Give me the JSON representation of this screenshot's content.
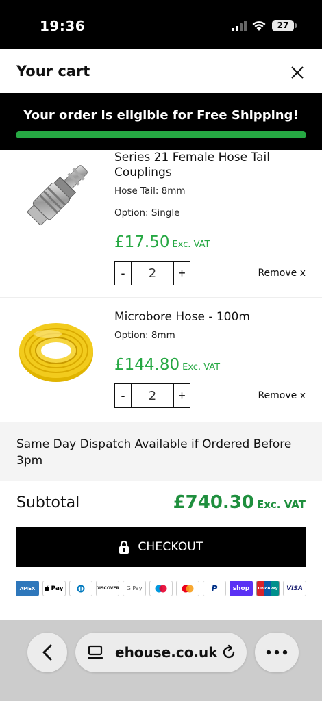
{
  "status_bar": {
    "time": "19:36",
    "battery": "27"
  },
  "cart": {
    "title": "Your cart"
  },
  "shipping_banner": {
    "text": "Your order is eligible for Free Shipping!",
    "progress_percent": 100,
    "color": "#26a843"
  },
  "items": [
    {
      "name": "Series 21 Female Hose Tail Couplings",
      "options": [
        "Hose Tail: 8mm",
        "Option: Single"
      ],
      "price": "£17.50",
      "vat_label": "Exc. VAT",
      "qty_minus": "-",
      "quantity": "2",
      "qty_plus": "+",
      "remove": "Remove x"
    },
    {
      "name": "Microbore Hose - 100m",
      "options": [
        "Option: 8mm"
      ],
      "price": "£144.80",
      "vat_label": "Exc. VAT",
      "qty_minus": "-",
      "quantity": "2",
      "qty_plus": "+",
      "remove": "Remove x"
    }
  ],
  "dispatch": {
    "text": "Same Day Dispatch Available if Ordered Before 3pm"
  },
  "subtotal": {
    "label": "Subtotal",
    "value": "£740.30",
    "vat_label": "Exc. VAT"
  },
  "checkout": {
    "label": "CHECKOUT"
  },
  "payment_methods": [
    {
      "name": "american-express",
      "label": "AMEX"
    },
    {
      "name": "apple-pay",
      "label": "Pay"
    },
    {
      "name": "diners-club",
      "label": ""
    },
    {
      "name": "discover",
      "label": "DISCOVER"
    },
    {
      "name": "google-pay",
      "label": "G Pay"
    },
    {
      "name": "maestro",
      "label": ""
    },
    {
      "name": "mastercard",
      "label": ""
    },
    {
      "name": "paypal",
      "label": "P"
    },
    {
      "name": "shop-pay",
      "label": "shop"
    },
    {
      "name": "unionpay",
      "label": "UnionPay"
    },
    {
      "name": "visa",
      "label": "VISA"
    }
  ],
  "browser": {
    "url": "ehouse.co.uk"
  },
  "colors": {
    "accent_green": "#26a843",
    "price_green": "#1f8f3e",
    "banner_bg": "#000000"
  }
}
